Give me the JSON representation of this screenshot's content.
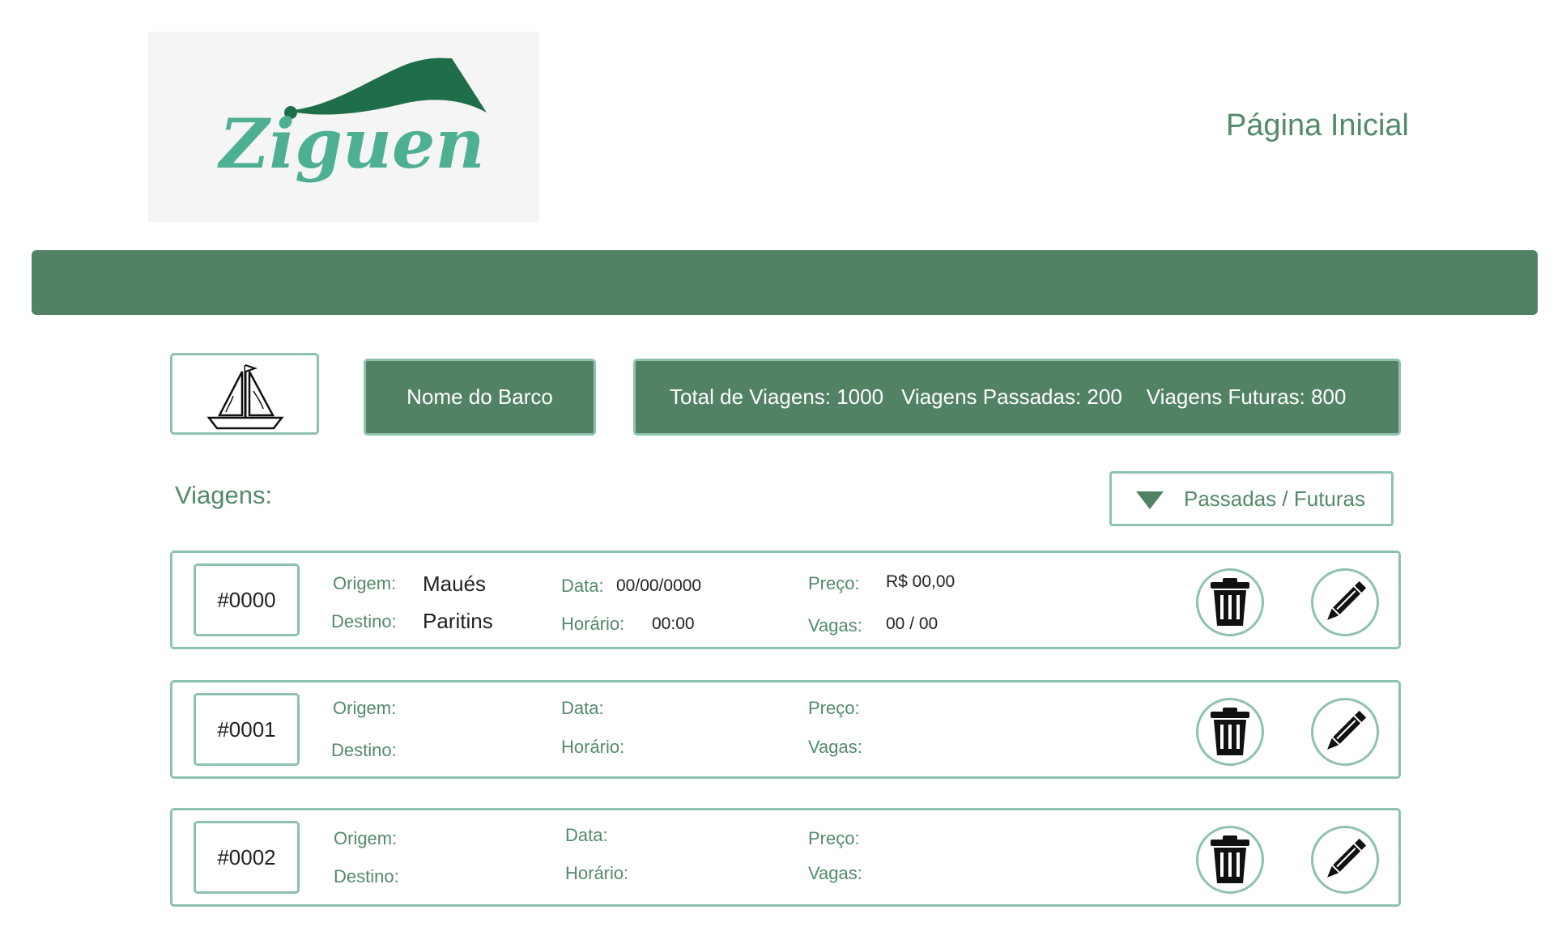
{
  "header": {
    "logo_text": "Ziguen",
    "nav_link": "Página Inicial"
  },
  "boat": {
    "name": "Nome do Barco",
    "stats": {
      "total": "Total de Viagens: 1000",
      "past": "Viagens Passadas: 200",
      "future": "Viagens Futuras: 800"
    }
  },
  "trips_section": {
    "title": "Viagens:",
    "filter_label": "Passadas / Futuras"
  },
  "labels": {
    "origin": "Origem:",
    "destination": "Destino:",
    "date": "Data:",
    "time": "Horário:",
    "price": "Preço:",
    "seats": "Vagas:"
  },
  "trips": [
    {
      "id": "#0000",
      "origin": "Maués",
      "destination": "Paritins",
      "date": "00/00/0000",
      "time": "00:00",
      "price": "R$ 00,00",
      "seats": "00 / 00"
    },
    {
      "id": "#0001",
      "origin": "",
      "destination": "",
      "date": "",
      "time": "",
      "price": "",
      "seats": ""
    },
    {
      "id": "#0002",
      "origin": "",
      "destination": "",
      "date": "",
      "time": "",
      "price": "",
      "seats": ""
    }
  ],
  "icons": {
    "boat": "sailboat-icon",
    "filter": "triangle-down-icon",
    "delete": "trash-icon",
    "edit": "pencil-icon"
  },
  "colors": {
    "primary": "#528264",
    "border": "#8ec2af",
    "text_green": "#528a6a",
    "logo_light": "#4eb093",
    "logo_dark": "#1f6e4a"
  }
}
